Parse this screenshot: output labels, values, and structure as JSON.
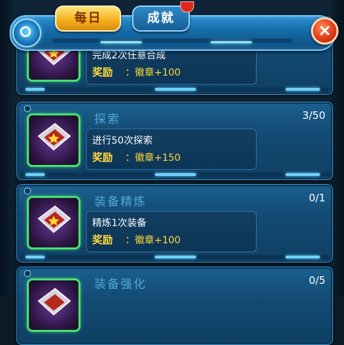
{
  "tabs": {
    "daily": "每日",
    "achievements": "成就"
  },
  "close_label": "×",
  "reward_label": "奖励",
  "tasks": [
    {
      "title": "",
      "progress": "",
      "description": "完成2次任意合成",
      "reward": "：徽章+100"
    },
    {
      "title": "探索",
      "progress": "3/50",
      "description": "进行50次探索",
      "reward": "：徽章+150"
    },
    {
      "title": "装备精炼",
      "progress": "0/1",
      "description": "精炼1次装备",
      "reward": "：徽章+100"
    },
    {
      "title": "装备强化",
      "progress": "0/5",
      "description": "",
      "reward": ""
    }
  ],
  "colors": {
    "accent_gold": "#ffd93a",
    "title_blue": "#4fa9d6",
    "frame_green": "#48e070",
    "close_red": "#e23a17"
  },
  "icons": {
    "menu": "ring-icon",
    "close": "close-icon",
    "task": "purple-diamond-badge-icon"
  }
}
